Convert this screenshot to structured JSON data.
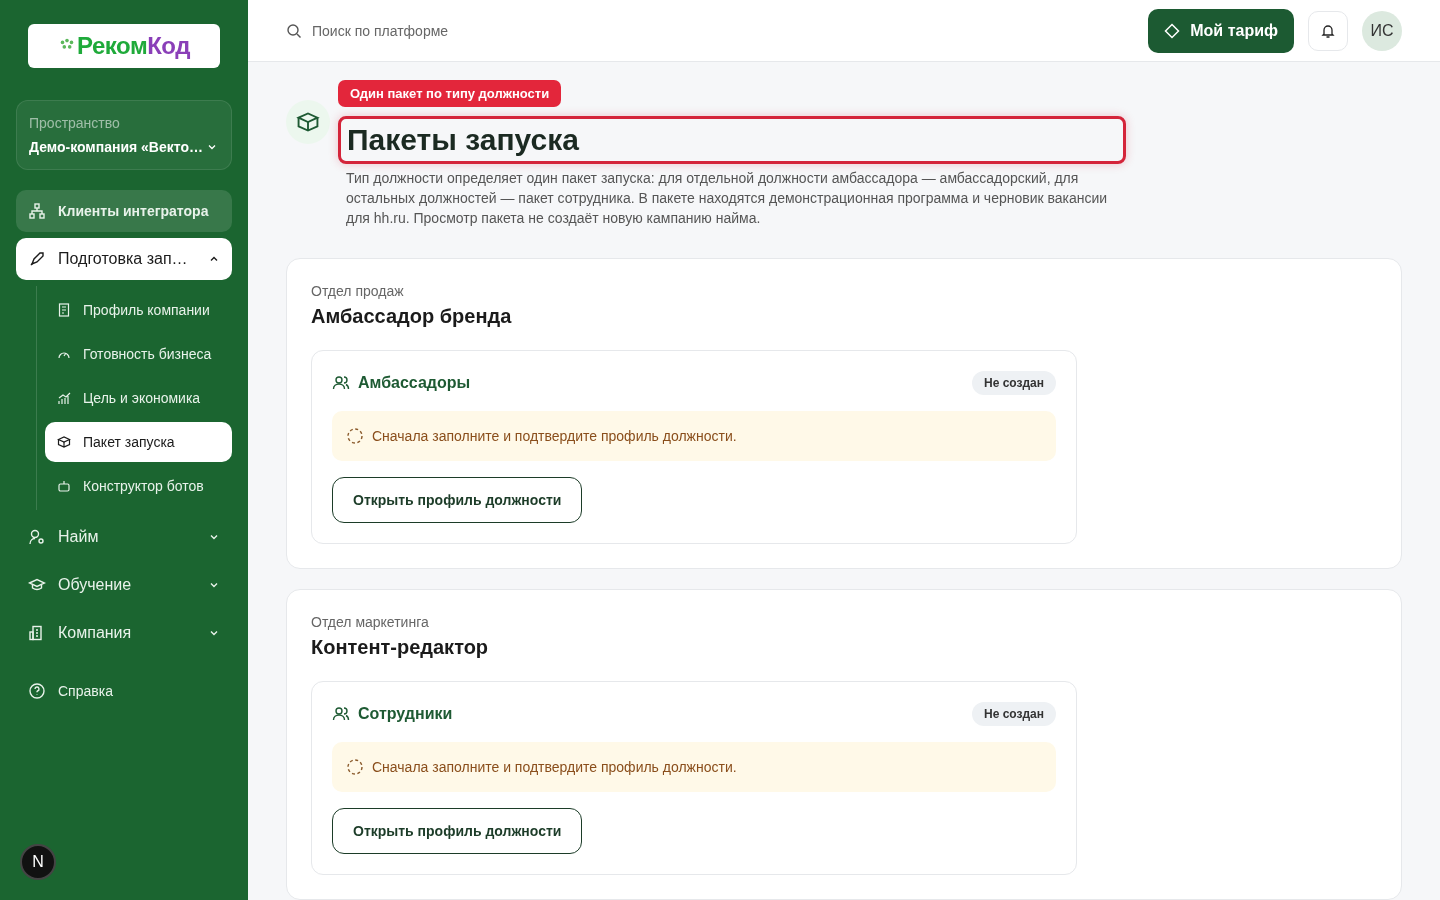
{
  "logo": {
    "part_1": "Реком",
    "part_2": "Код"
  },
  "workspace": {
    "label": "Пространство",
    "value": "Демо-компания «Векто…"
  },
  "nav": [
    {
      "label": "Клиенты интегратора",
      "kind": "primary",
      "selected": false
    },
    {
      "label": "Подготовка зап…",
      "kind": "group",
      "selected": true,
      "expanded": true,
      "children": [
        {
          "label": "Профиль компании",
          "selected": false
        },
        {
          "label": "Готовность бизнеса",
          "selected": false
        },
        {
          "label": "Цель и экономика",
          "selected": false
        },
        {
          "label": "Пакет запуска",
          "selected": true
        },
        {
          "label": "Конструктор ботов",
          "selected": false
        }
      ]
    },
    {
      "label": "Найм",
      "kind": "group",
      "selected": false,
      "expanded": false
    },
    {
      "label": "Обучение",
      "kind": "group",
      "selected": false,
      "expanded": false
    },
    {
      "label": "Компания",
      "kind": "group",
      "selected": false,
      "expanded": false
    },
    {
      "label": "Справка",
      "kind": "link",
      "selected": false
    }
  ],
  "dev_badge": "N",
  "search": {
    "placeholder": "Поиск по платформе"
  },
  "plan_button": "Мой тариф",
  "avatar": "ИС",
  "page": {
    "tour_badge": "Один пакет по типу должности",
    "title": "Пакеты запуска",
    "description": "Тип должности определяет один пакет запуска: для отдельной должности амбассадора — амбассадорский, для остальных должностей — пакет сотрудника. В пакете находятся демонстрационная программа и черновик вакансии для hh.ru. Просмотр пакета не создаёт новую кампанию найма."
  },
  "sections": [
    {
      "department": "Отдел продаж",
      "title": "Амбассадор бренда",
      "package": {
        "title": "Амбассадоры",
        "status": "Не создан",
        "notice": "Сначала заполните и подтвердите профиль должности.",
        "button": "Открыть профиль должности"
      }
    },
    {
      "department": "Отдел маркетинга",
      "title": "Контент-редактор",
      "package": {
        "title": "Сотрудники",
        "status": "Не создан",
        "notice": "Сначала заполните и подтвердите профиль должности.",
        "button": "Открыть профиль должности"
      }
    }
  ]
}
